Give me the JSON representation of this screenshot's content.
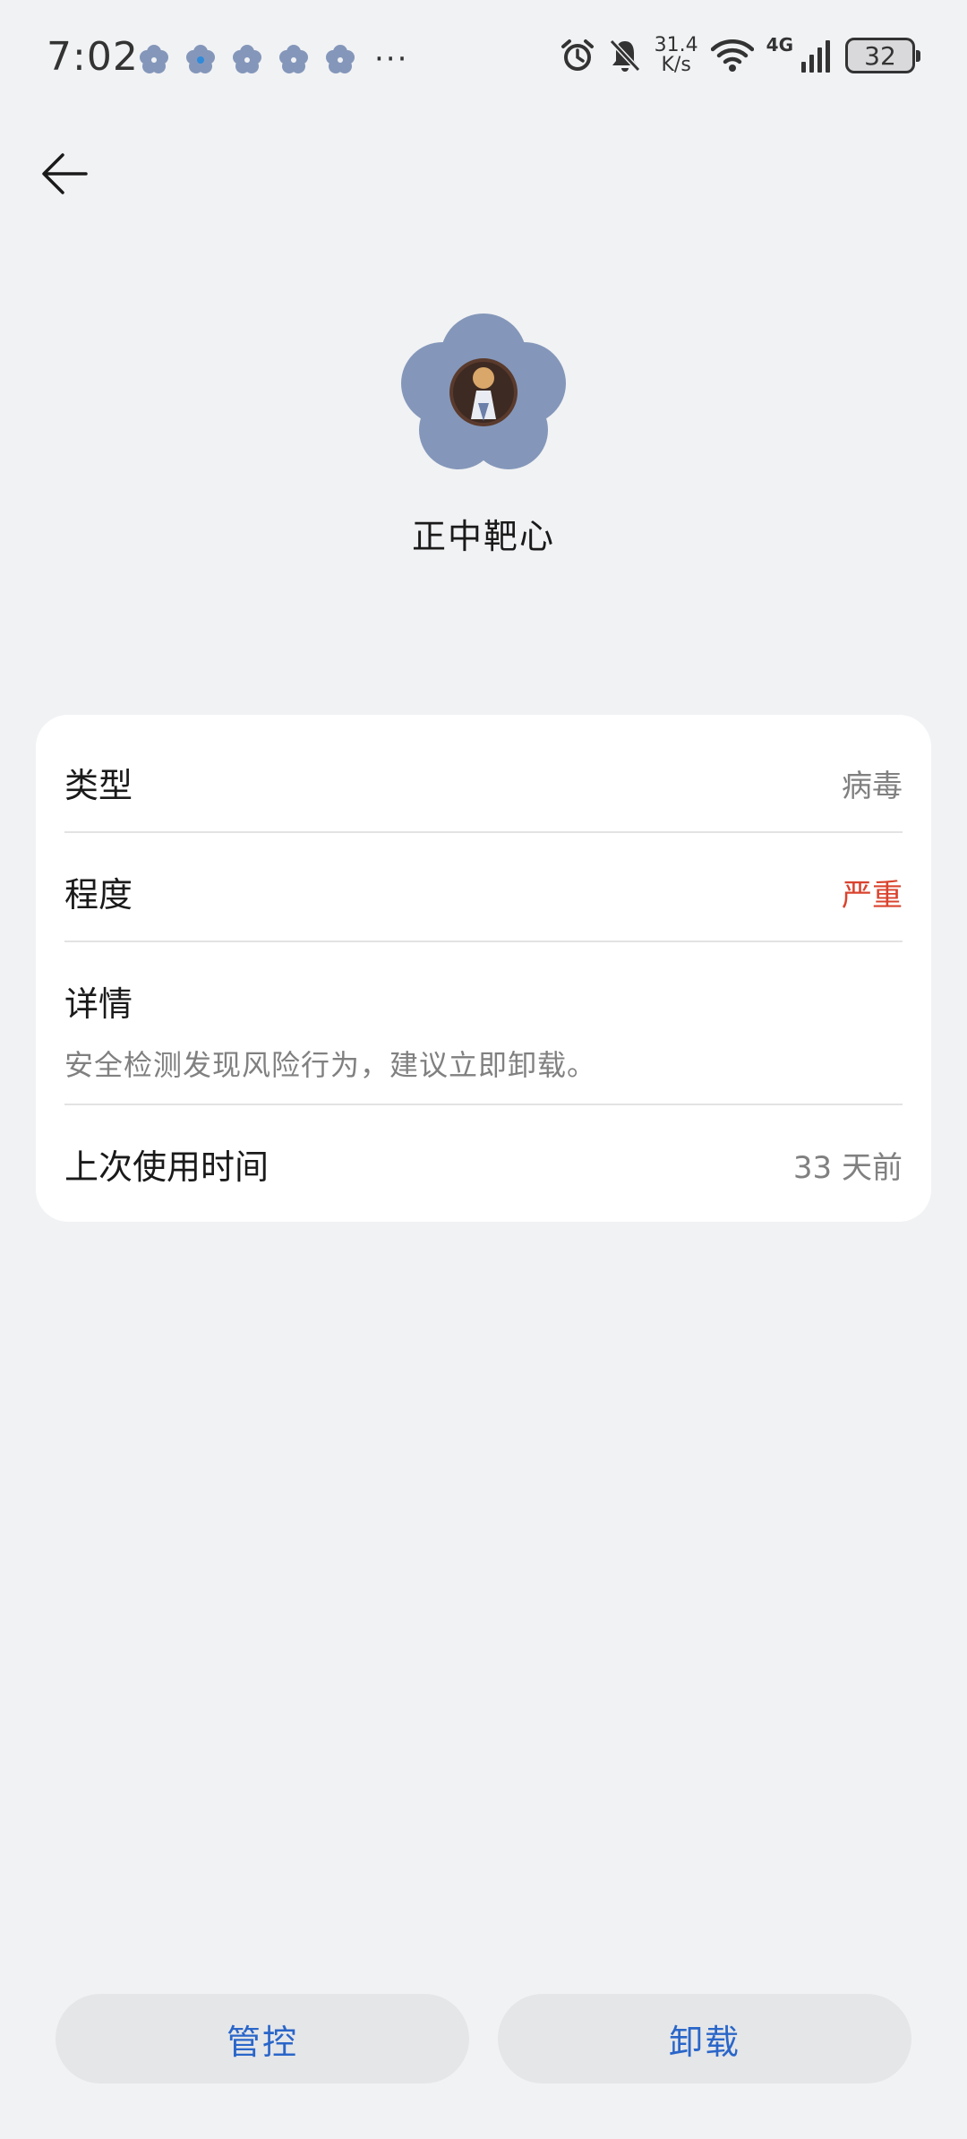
{
  "status_bar": {
    "time": "7:02",
    "notification_icons": [
      "flower-icon",
      "flower-icon",
      "flower-icon",
      "flower-icon",
      "flower-icon"
    ],
    "more": "···",
    "net_speed_value": "31.4",
    "net_speed_unit": "K/s",
    "network_type": "4G",
    "battery": "32"
  },
  "app": {
    "name": "正中靶心"
  },
  "details": {
    "type_label": "类型",
    "type_value": "病毒",
    "severity_label": "程度",
    "severity_value": "严重",
    "detail_label": "详情",
    "detail_text": "安全检测发现风险行为，建议立即卸载。",
    "last_used_label": "上次使用时间",
    "last_used_value": "33 天前"
  },
  "actions": {
    "control_label": "管控",
    "uninstall_label": "卸载"
  },
  "colors": {
    "accent": "#2a66c9",
    "danger": "#d9432e",
    "background": "#f1f2f4",
    "icon_flower": "#8497ba"
  }
}
